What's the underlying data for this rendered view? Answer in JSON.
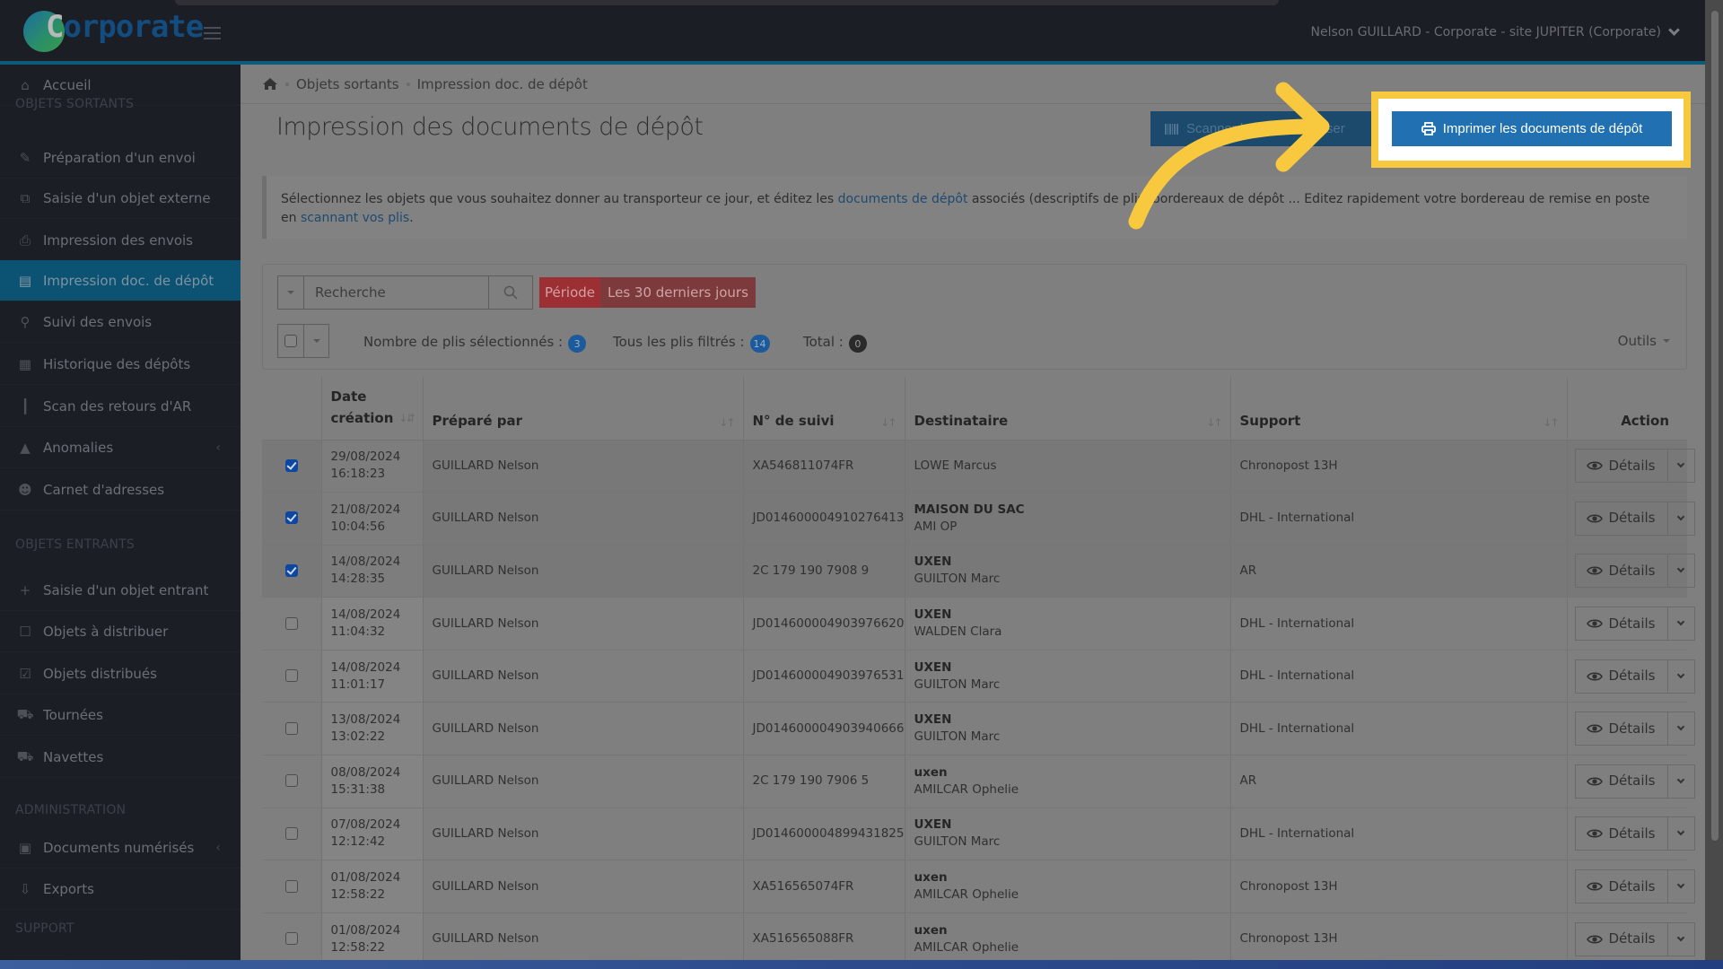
{
  "header": {
    "logo_text_first": "C",
    "logo_text_rest": "orporate",
    "user_menu": "Nelson GUILLARD - Corporate - site JUPITER (Corporate)"
  },
  "sidebar": {
    "items": [
      {
        "label": "Accueil",
        "icon": "home-icon"
      },
      {
        "section": "OBJETS SORTANTS"
      },
      {
        "label": "Préparation d'un envoi",
        "icon": "pencil-icon"
      },
      {
        "label": "Saisie d'un objet externe",
        "icon": "external-link-icon"
      },
      {
        "label": "Impression des envois",
        "icon": "printer-icon"
      },
      {
        "label": "Impression doc. de dépôt",
        "icon": "document-icon",
        "active": true
      },
      {
        "label": "Suivi des envois",
        "icon": "search-icon"
      },
      {
        "label": "Historique des dépôts",
        "icon": "calendar-icon"
      },
      {
        "label": "Scan des retours d'AR",
        "icon": "barcode-icon"
      },
      {
        "label": "Anomalies",
        "icon": "warning-icon",
        "has_children": true
      },
      {
        "label": "Carnet d'adresses",
        "icon": "users-icon"
      },
      {
        "section": "OBJETS ENTRANTS"
      },
      {
        "label": "Saisie d'un objet entrant",
        "icon": "plus-icon"
      },
      {
        "label": "Objets à distribuer",
        "icon": "square-icon"
      },
      {
        "label": "Objets distribués",
        "icon": "check-square-icon"
      },
      {
        "label": "Tournées",
        "icon": "cart-icon"
      },
      {
        "label": "Navettes",
        "icon": "truck-icon"
      },
      {
        "section": "ADMINISTRATION"
      },
      {
        "label": "Documents numérisés",
        "icon": "qrcode-icon",
        "has_children": true
      },
      {
        "label": "Exports",
        "icon": "download-icon"
      },
      {
        "section": "SUPPORT"
      }
    ]
  },
  "breadcrumb": {
    "items": [
      "Objets sortants",
      "Impression doc. de dépôt"
    ]
  },
  "page": {
    "title": "Impression des documents de dépôt",
    "scan_button": "Scanner les plis à déposer",
    "print_button": "Imprimer les documents de dépôt",
    "highlight_color": "#f8c93e"
  },
  "info": {
    "text_1": "Sélectionnez les objets que vous souhaitez donner au transporteur ce jour, et éditez les ",
    "link_1": "documents de dépôt",
    "text_2": " associés (descriptifs de plis, bordereaux de dépôt ... Editez rapidement votre bordereau de remise en poste en ",
    "link_2": "scannant vos plis",
    "text_3": "."
  },
  "filters": {
    "search_placeholder": "Recherche",
    "search_value": "",
    "period_label": "Période",
    "period_value": "Les 30 derniers jours",
    "selected_label": "Nombre de plis sélectionnés :",
    "selected_count": "3",
    "filtered_label": "Tous les plis filtrés :",
    "filtered_count": "14",
    "total_label": "Total :",
    "total_count": "0",
    "tools_label": "Outils"
  },
  "table": {
    "headers": {
      "date": "Date création",
      "prepared_by": "Préparé par",
      "tracking": "N° de suivi",
      "recipient": "Destinataire",
      "support": "Support",
      "action": "Action"
    },
    "details_label": "Détails",
    "rows": [
      {
        "checked": true,
        "date": "29/08/2024",
        "time": "16:18:23",
        "prepared_by": "GUILLARD Nelson",
        "tracking": "XA546811074FR",
        "org": "",
        "name": "LOWE Marcus",
        "support": "Chronopost 13H"
      },
      {
        "checked": true,
        "date": "21/08/2024",
        "time": "10:04:56",
        "prepared_by": "GUILLARD Nelson",
        "tracking": "JD014600004910276413",
        "org": "MAISON DU SAC",
        "name": "AMI OP",
        "support": "DHL - International"
      },
      {
        "checked": true,
        "date": "14/08/2024",
        "time": "14:28:35",
        "prepared_by": "GUILLARD Nelson",
        "tracking": "2C 179 190 7908 9",
        "org": "UXEN",
        "name": "GUILTON Marc",
        "support": "AR"
      },
      {
        "checked": false,
        "date": "14/08/2024",
        "time": "11:04:32",
        "prepared_by": "GUILLARD Nelson",
        "tracking": "JD014600004903976620",
        "org": "UXEN",
        "name": "WALDEN Clara",
        "support": "DHL - International"
      },
      {
        "checked": false,
        "date": "14/08/2024",
        "time": "11:01:17",
        "prepared_by": "GUILLARD Nelson",
        "tracking": "JD014600004903976531",
        "org": "UXEN",
        "name": "GUILTON Marc",
        "support": "DHL - International"
      },
      {
        "checked": false,
        "date": "13/08/2024",
        "time": "13:02:22",
        "prepared_by": "GUILLARD Nelson",
        "tracking": "JD014600004903940666",
        "org": "UXEN",
        "name": "GUILTON Marc",
        "support": "DHL - International"
      },
      {
        "checked": false,
        "date": "08/08/2024",
        "time": "15:31:38",
        "prepared_by": "GUILLARD Nelson",
        "tracking": "2C 179 190 7906 5",
        "org": "uxen",
        "name": "AMILCAR Ophelie",
        "support": "AR"
      },
      {
        "checked": false,
        "date": "07/08/2024",
        "time": "12:12:42",
        "prepared_by": "GUILLARD Nelson",
        "tracking": "JD014600004899431825",
        "org": "UXEN",
        "name": "GUILTON Marc",
        "support": "DHL - International"
      },
      {
        "checked": false,
        "date": "01/08/2024",
        "time": "12:58:22",
        "prepared_by": "GUILLARD Nelson",
        "tracking": "XA516565074FR",
        "org": "uxen",
        "name": "AMILCAR Ophelie",
        "support": "Chronopost 13H"
      },
      {
        "checked": false,
        "date": "01/08/2024",
        "time": "12:58:22",
        "prepared_by": "GUILLARD Nelson",
        "tracking": "XA516565088FR",
        "org": "uxen",
        "name": "AMILCAR Ophelie",
        "support": "Chronopost 13H"
      }
    ]
  }
}
